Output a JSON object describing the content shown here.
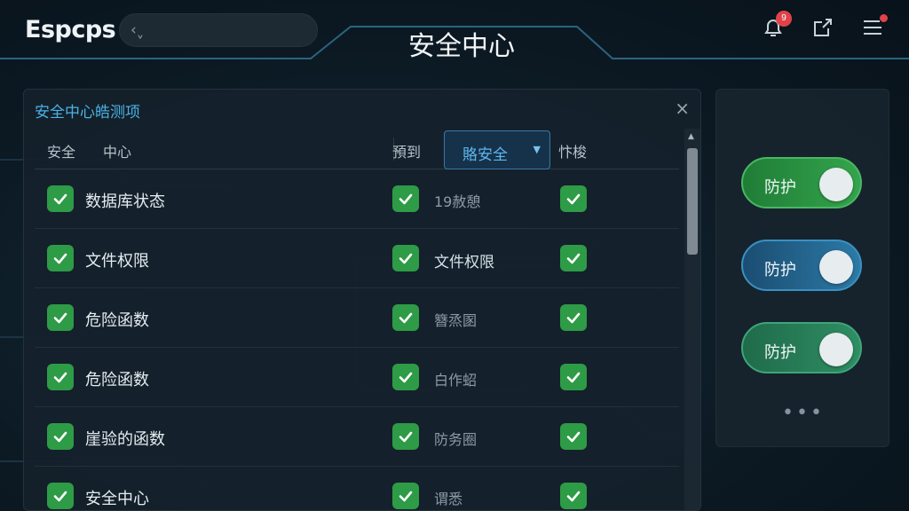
{
  "app": {
    "logo": "Espcps",
    "page_title": "安全中心",
    "notification_count": "9"
  },
  "icons": {
    "back": "back-chevron-icon",
    "bell": "bell-icon",
    "export": "export-icon",
    "menu": "menu-icon"
  },
  "panel": {
    "title": "安全中心皓测项",
    "close": "×",
    "header": {
      "col1": "安全",
      "col2": "中心",
      "col3": "預到",
      "select_value": "賂安全",
      "col5": "忭梭"
    },
    "rows": [
      {
        "label": "数据库状态",
        "sub": "19赦憩",
        "sub_bright": false
      },
      {
        "label": "文件权限",
        "sub": "文件权限",
        "sub_bright": true
      },
      {
        "label": "危险函数",
        "sub": "簪烝圂",
        "sub_bright": false
      },
      {
        "label": "危险函数",
        "sub": "白作蛁",
        "sub_bright": false
      },
      {
        "label": "崖验的函数",
        "sub": "防务圈",
        "sub_bright": false
      },
      {
        "label": "安全中心",
        "sub": "谓悉",
        "sub_bright": false
      }
    ]
  },
  "side": {
    "toggles": [
      {
        "label": "防护",
        "color": "#34a54c",
        "on": true
      },
      {
        "label": "防护",
        "color": "#2c7aa6",
        "on": true
      },
      {
        "label": "防护",
        "color": "#2f8e63",
        "on": true
      }
    ],
    "more": "•••"
  },
  "colors": {
    "accent": "#49b2e6",
    "check_green": "#2e9b46",
    "badge_red": "#e0424a"
  }
}
